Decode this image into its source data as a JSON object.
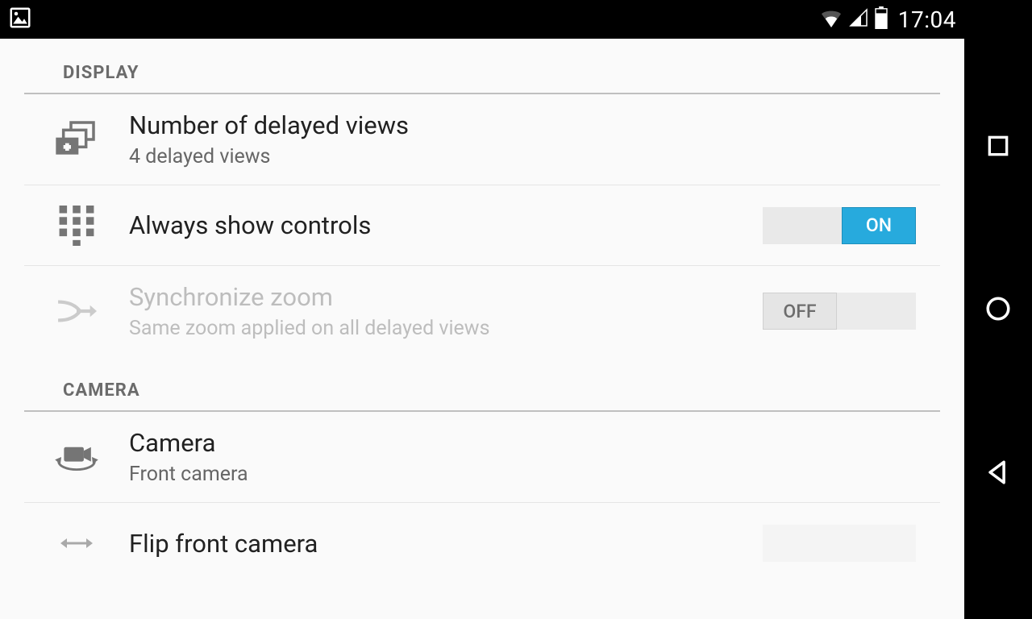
{
  "status_bar": {
    "time": "17:04"
  },
  "sections": {
    "display": {
      "header": "DISPLAY",
      "items": {
        "delayed_views": {
          "title": "Number of delayed views",
          "sub": "4 delayed views"
        },
        "always_show_controls": {
          "title": "Always show controls",
          "toggle": "ON"
        },
        "sync_zoom": {
          "title": "Synchronize zoom",
          "sub": "Same zoom applied on all delayed views",
          "toggle": "OFF"
        }
      }
    },
    "camera": {
      "header": "CAMERA",
      "items": {
        "camera": {
          "title": "Camera",
          "sub": "Front camera"
        },
        "flip_front": {
          "title": "Flip front camera"
        }
      }
    }
  },
  "toggles": {
    "on_label": "ON",
    "off_label": "OFF"
  }
}
